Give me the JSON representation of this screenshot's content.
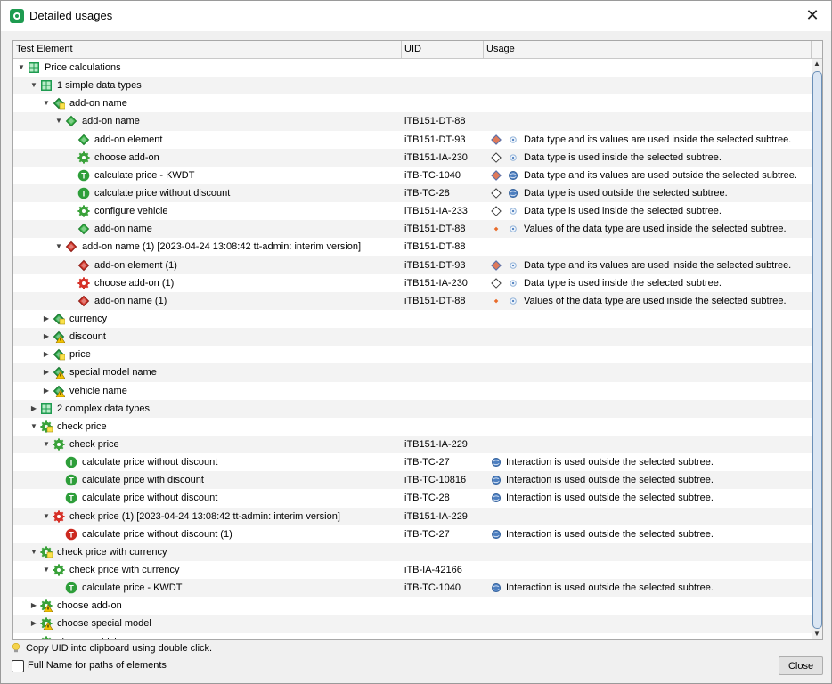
{
  "window": {
    "title": "Detailed usages",
    "close_label": "✕"
  },
  "columns": [
    "Test Element",
    "UID",
    "Usage"
  ],
  "rows": [
    {
      "indent": 0,
      "toggle": "open",
      "icon": "package",
      "label": "Price calculations",
      "uid": "",
      "u1": "",
      "u2": "",
      "usage": ""
    },
    {
      "indent": 1,
      "toggle": "open",
      "icon": "package",
      "label": "1 simple data types",
      "uid": "",
      "u1": "",
      "u2": "",
      "usage": ""
    },
    {
      "indent": 2,
      "toggle": "open",
      "icon": "dt-group",
      "label": "add-on name",
      "uid": "",
      "u1": "",
      "u2": "",
      "usage": ""
    },
    {
      "indent": 3,
      "toggle": "open",
      "icon": "dt-green",
      "label": "add-on name",
      "uid": "iTB151-DT-88",
      "u1": "",
      "u2": "",
      "usage": ""
    },
    {
      "indent": 4,
      "toggle": "",
      "icon": "dt-green",
      "label": "add-on element",
      "uid": "iTB151-DT-93",
      "u1": "diamond-full",
      "u2": "inside",
      "usage": "Data type and its values are used inside the selected subtree."
    },
    {
      "indent": 4,
      "toggle": "",
      "icon": "gear-green",
      "label": "choose add-on",
      "uid": "iTB151-IA-230",
      "u1": "diamond-empty",
      "u2": "inside",
      "usage": "Data type is used inside the selected subtree."
    },
    {
      "indent": 4,
      "toggle": "",
      "icon": "t-green",
      "label": "calculate price - KWDT",
      "uid": "iTB-TC-1040",
      "u1": "diamond-full",
      "u2": "outside",
      "usage": "Data type and its values are used outside the selected subtree."
    },
    {
      "indent": 4,
      "toggle": "",
      "icon": "t-green",
      "label": "calculate price without discount",
      "uid": "iTB-TC-28",
      "u1": "diamond-empty",
      "u2": "outside",
      "usage": "Data type is used outside the selected subtree."
    },
    {
      "indent": 4,
      "toggle": "",
      "icon": "gear-green",
      "label": "configure vehicle",
      "uid": "iTB151-IA-233",
      "u1": "diamond-empty",
      "u2": "inside",
      "usage": "Data type is used inside the selected subtree."
    },
    {
      "indent": 4,
      "toggle": "",
      "icon": "dt-green",
      "label": "add-on name",
      "uid": "iTB151-DT-88",
      "u1": "diamond-small",
      "u2": "inside",
      "usage": "Values of the data type are used inside the selected subtree."
    },
    {
      "indent": 3,
      "toggle": "open",
      "icon": "dt-red",
      "label": "add-on name (1) [2023-04-24 13:08:42 tt-admin: interim version]",
      "uid": "iTB151-DT-88",
      "u1": "",
      "u2": "",
      "usage": ""
    },
    {
      "indent": 4,
      "toggle": "",
      "icon": "dt-red",
      "label": "add-on element (1)",
      "uid": "iTB151-DT-93",
      "u1": "diamond-full",
      "u2": "inside",
      "usage": "Data type and its values are used inside the selected subtree."
    },
    {
      "indent": 4,
      "toggle": "",
      "icon": "gear-red",
      "label": "choose add-on (1)",
      "uid": "iTB151-IA-230",
      "u1": "diamond-empty",
      "u2": "inside",
      "usage": "Data type is used inside the selected subtree."
    },
    {
      "indent": 4,
      "toggle": "",
      "icon": "dt-red",
      "label": "add-on name (1)",
      "uid": "iTB151-DT-88",
      "u1": "diamond-small",
      "u2": "inside",
      "usage": "Values of the data type are used inside the selected subtree."
    },
    {
      "indent": 2,
      "toggle": "closed",
      "icon": "dt-group",
      "label": "currency",
      "uid": "",
      "u1": "",
      "u2": "",
      "usage": ""
    },
    {
      "indent": 2,
      "toggle": "closed",
      "icon": "dt-group-warn",
      "label": "discount",
      "uid": "",
      "u1": "",
      "u2": "",
      "usage": ""
    },
    {
      "indent": 2,
      "toggle": "closed",
      "icon": "dt-group",
      "label": "price",
      "uid": "",
      "u1": "",
      "u2": "",
      "usage": ""
    },
    {
      "indent": 2,
      "toggle": "closed",
      "icon": "dt-group-warn",
      "label": "special model name",
      "uid": "",
      "u1": "",
      "u2": "",
      "usage": ""
    },
    {
      "indent": 2,
      "toggle": "closed",
      "icon": "dt-group-warn",
      "label": "vehicle name",
      "uid": "",
      "u1": "",
      "u2": "",
      "usage": ""
    },
    {
      "indent": 1,
      "toggle": "closed",
      "icon": "package",
      "label": "2 complex data types",
      "uid": "",
      "u1": "",
      "u2": "",
      "usage": ""
    },
    {
      "indent": 1,
      "toggle": "open",
      "icon": "gear-group",
      "label": "check price",
      "uid": "",
      "u1": "",
      "u2": "",
      "usage": ""
    },
    {
      "indent": 2,
      "toggle": "open",
      "icon": "gear-green",
      "label": "check price",
      "uid": "iTB151-IA-229",
      "u1": "",
      "u2": "",
      "usage": ""
    },
    {
      "indent": 3,
      "toggle": "",
      "icon": "t-green",
      "label": "calculate price without discount",
      "uid": "iTB-TC-27",
      "u1": "outside",
      "u2": "",
      "usage": "Interaction is used outside the selected subtree."
    },
    {
      "indent": 3,
      "toggle": "",
      "icon": "t-green",
      "label": "calculate price with discount",
      "uid": "iTB-TC-10816",
      "u1": "outside",
      "u2": "",
      "usage": "Interaction is used outside the selected subtree."
    },
    {
      "indent": 3,
      "toggle": "",
      "icon": "t-green",
      "label": "calculate price without discount",
      "uid": "iTB-TC-28",
      "u1": "outside",
      "u2": "",
      "usage": "Interaction is used outside the selected subtree."
    },
    {
      "indent": 2,
      "toggle": "open",
      "icon": "gear-red",
      "label": "check price (1) [2023-04-24 13:08:42 tt-admin: interim version]",
      "uid": "iTB151-IA-229",
      "u1": "",
      "u2": "",
      "usage": ""
    },
    {
      "indent": 3,
      "toggle": "",
      "icon": "t-red",
      "label": "calculate price without discount (1)",
      "uid": "iTB-TC-27",
      "u1": "outside",
      "u2": "",
      "usage": "Interaction is used outside the selected subtree."
    },
    {
      "indent": 1,
      "toggle": "open",
      "icon": "gear-group",
      "label": "check price with currency",
      "uid": "",
      "u1": "",
      "u2": "",
      "usage": ""
    },
    {
      "indent": 2,
      "toggle": "open",
      "icon": "gear-green",
      "label": "check price with currency",
      "uid": "iTB-IA-42166",
      "u1": "",
      "u2": "",
      "usage": ""
    },
    {
      "indent": 3,
      "toggle": "",
      "icon": "t-green",
      "label": "calculate price - KWDT",
      "uid": "iTB-TC-1040",
      "u1": "outside",
      "u2": "",
      "usage": "Interaction is used outside the selected subtree."
    },
    {
      "indent": 1,
      "toggle": "closed",
      "icon": "gear-group-warn",
      "label": "choose add-on",
      "uid": "",
      "u1": "",
      "u2": "",
      "usage": ""
    },
    {
      "indent": 1,
      "toggle": "closed",
      "icon": "gear-group-warn",
      "label": "choose special model",
      "uid": "",
      "u1": "",
      "u2": "",
      "usage": ""
    },
    {
      "indent": 1,
      "toggle": "closed",
      "icon": "gear-group-warn",
      "label": "choose vehicle",
      "uid": "",
      "u1": "",
      "u2": "",
      "usage": ""
    }
  ],
  "footer": {
    "hint": "Copy UID into clipboard using double click.",
    "checkbox_label": "Full Name for paths of elements",
    "checkbox_checked": false,
    "close_button": "Close"
  }
}
